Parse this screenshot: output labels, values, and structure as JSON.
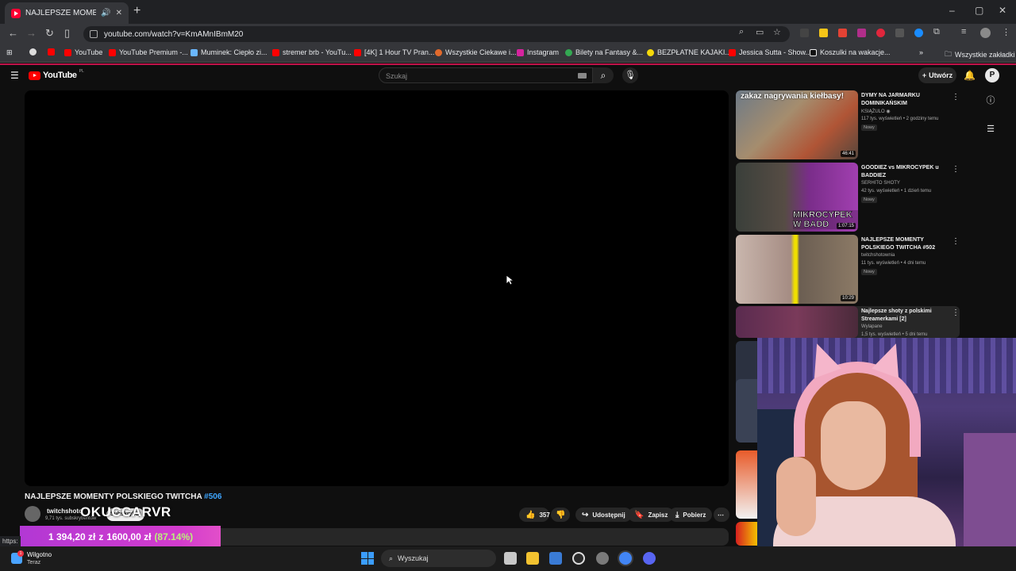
{
  "browser": {
    "tab_title": "NAJLEPSZE MOMENTY POL",
    "new_tab": "+",
    "url": "youtube.com/watch?v=KmAMnIBmM20",
    "window_controls": [
      "–",
      "▢",
      "✕"
    ]
  },
  "bookmarks": [
    {
      "label": "",
      "color": "#dddddd"
    },
    {
      "label": "",
      "color": "#ff0000"
    },
    {
      "label": "YouTube",
      "color": "#ff0000"
    },
    {
      "label": "YouTube Premium -...",
      "color": "#ff0000"
    },
    {
      "label": "Muminek: Ciepło zi...",
      "color": "#6ab7ff"
    },
    {
      "label": "stremer brb - YouTu...",
      "color": "#ff0000"
    },
    {
      "label": "[4K] 1 Hour TV Pran...",
      "color": "#ff0000"
    },
    {
      "label": "Wszystkie Ciekawe i...",
      "color": "#e26a2c"
    },
    {
      "label": "Instagram",
      "color": "#d6249f"
    },
    {
      "label": "Bilety na Fantasy &...",
      "color": "#33a852"
    },
    {
      "label": "BEZPŁATNE KAJAKI...",
      "color": "#f5d90a"
    },
    {
      "label": "Jessica Sutta - Show...",
      "color": "#ff0000"
    },
    {
      "label": "Koszulki na wakacje...",
      "color": "#111111"
    }
  ],
  "bookmarks_more": "»",
  "bookmarks_all": "Wszystkie zakładki",
  "youtube": {
    "logo_text": "YouTube",
    "region": "PL",
    "search_placeholder": "Szukaj",
    "create_label": "Utwórz",
    "profile_initial": "P"
  },
  "video": {
    "title": "NAJLEPSZE MOMENTY POLSKIEGO TWITCHA",
    "title_tag": "#506",
    "channel": "twitchshoto",
    "subscribers": "9,71 tys. subskrybentów",
    "subscribe_label": "Subskrybuj",
    "likes": "357",
    "share_label": "Udostępnij",
    "save_label": "Zapisz",
    "download_label": "Pobierz",
    "more_label": "⋯"
  },
  "overlay": {
    "streamer_name": "OKUCCARVR",
    "goal_current": "1 394,20 zł",
    "goal_sep": "z",
    "goal_target": "1600,00 zł",
    "goal_percent": "(87.14%)",
    "status_url": "https:"
  },
  "recommendations": [
    {
      "title": "DYMY NA JARMARKU DOMINIKAŃSKIM",
      "channel": "KSIĄŻULO ◉",
      "meta": "117 tys. wyświetleń • 2 godziny temu",
      "badge": "Nowy",
      "duration": "46:41",
      "thumb_text": "zakaz nagrywania kiełbasy!"
    },
    {
      "title": "GOODIEZ vs MIKROCYPEK u BADDIEZ",
      "channel": "SERHITO SHOTY",
      "meta": "42 tys. wyświetleń • 1 dzień temu",
      "badge": "Nowy",
      "duration": "1:07:15",
      "thumb_text": "MIKROCYPEK W BADD"
    },
    {
      "title": "NAJLEPSZE MOMENTY POLSKIEGO TWITCHA #502",
      "channel": "twitchshotownia",
      "meta": "11 tys. wyświetleń • 4 dni temu",
      "badge": "Nowy",
      "duration": "10:29",
      "thumb_text": ""
    },
    {
      "title": "Najlepsze shoty z polskimi Streamerkami [2]",
      "channel": "Wylapane",
      "meta": "1,5 tys. wyświetleń • 5 dni temu",
      "badge": "",
      "duration": "",
      "thumb_text": ""
    }
  ],
  "taskbar": {
    "weather_title": "Wilgotno",
    "weather_sub": "Teraz",
    "weather_badge": "1",
    "search_label": "Wyszukaj"
  }
}
